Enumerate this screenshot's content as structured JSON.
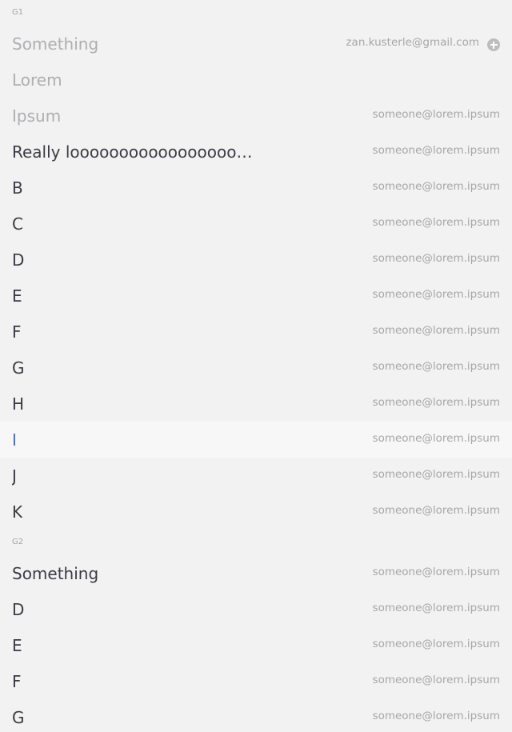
{
  "groups": [
    {
      "label": "G1",
      "rows": [
        {
          "name": "Something",
          "email": "zan.kusterle@gmail.com",
          "icon": "add-circle-icon"
        },
        {
          "name": "Lorem",
          "email": ""
        },
        {
          "name": "Ipsum",
          "email": "someone@lorem.ipsum"
        },
        {
          "name": "Really looooooooooooooooooooooooooooooooong",
          "email": "someone@lorem.ipsum"
        },
        {
          "name": "B",
          "email": "someone@lorem.ipsum"
        },
        {
          "name": "C",
          "email": "someone@lorem.ipsum"
        },
        {
          "name": "D",
          "email": "someone@lorem.ipsum"
        },
        {
          "name": "E",
          "email": "someone@lorem.ipsum"
        },
        {
          "name": "F",
          "email": "someone@lorem.ipsum"
        },
        {
          "name": "G",
          "email": "someone@lorem.ipsum"
        },
        {
          "name": "H",
          "email": "someone@lorem.ipsum"
        },
        {
          "name": "I",
          "email": "someone@lorem.ipsum",
          "selected": true
        },
        {
          "name": "J",
          "email": "someone@lorem.ipsum"
        },
        {
          "name": "K",
          "email": "someone@lorem.ipsum"
        }
      ]
    },
    {
      "label": "G2",
      "rows": [
        {
          "name": "Something",
          "email": "someone@lorem.ipsum"
        },
        {
          "name": "D",
          "email": "someone@lorem.ipsum"
        },
        {
          "name": "E",
          "email": "someone@lorem.ipsum"
        },
        {
          "name": "F",
          "email": "someone@lorem.ipsum"
        },
        {
          "name": "G",
          "email": "someone@lorem.ipsum"
        }
      ]
    }
  ],
  "colors": {
    "background": "#f2f2f2",
    "selected_row": "#f7f7f7",
    "selected_text": "#4a6fbf",
    "muted_text": "#aeaeb3",
    "primary_text": "#3b3b45"
  }
}
